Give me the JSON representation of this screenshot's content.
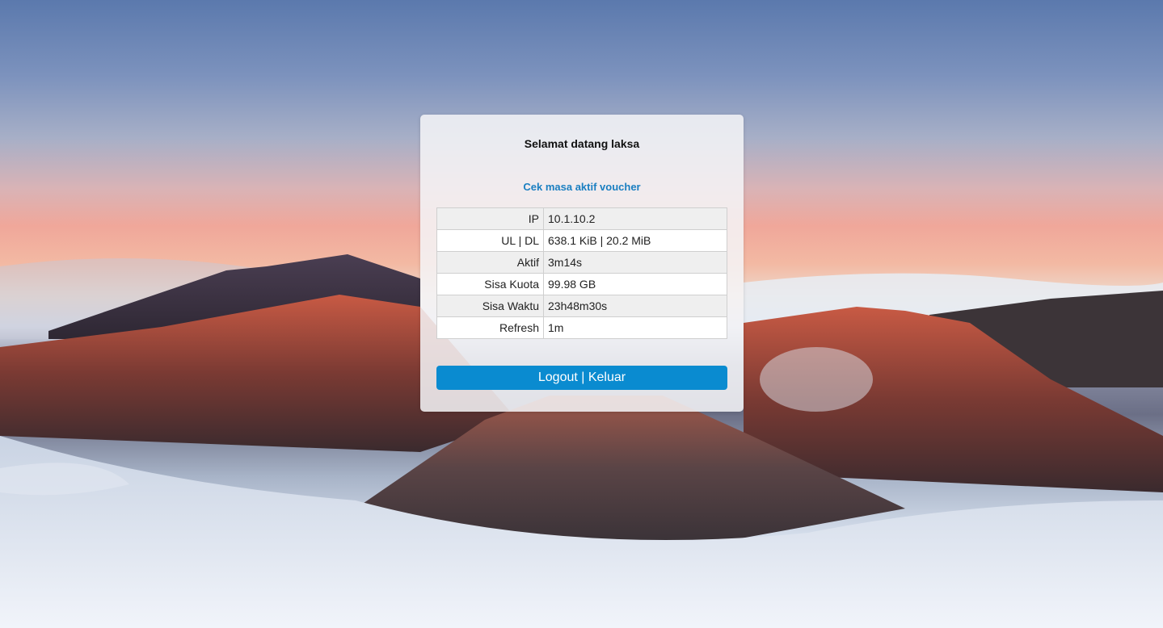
{
  "welcome": {
    "text": "Selamat datang laksa"
  },
  "voucher_link": {
    "label": "Cek masa aktif voucher"
  },
  "status": {
    "rows": [
      {
        "label": "IP",
        "value": "10.1.10.2"
      },
      {
        "label": "UL | DL",
        "value": "638.1 KiB | 20.2 MiB"
      },
      {
        "label": "Aktif",
        "value": "3m14s"
      },
      {
        "label": "Sisa Kuota",
        "value": "99.98 GB"
      },
      {
        "label": "Sisa Waktu",
        "value": "23h48m30s"
      },
      {
        "label": "Refresh",
        "value": "1m"
      }
    ]
  },
  "logout_button": {
    "label": "Logout | Keluar"
  },
  "colors": {
    "accent": "#0a8bd0",
    "link": "#1a7fc1"
  }
}
